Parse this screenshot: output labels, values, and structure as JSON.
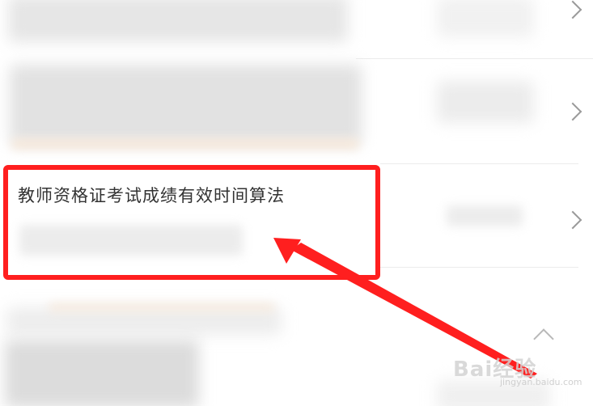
{
  "list": {
    "highlighted_item": {
      "title": "教师资格证考试成绩有效时间算法"
    }
  },
  "watermark": {
    "text": "Bai经验",
    "url": "jingyan.baidu.com"
  },
  "icons": {
    "row_chevron": "chevron-right-icon",
    "scroll_top": "chevron-up-icon"
  },
  "colors": {
    "highlight": "#ff1f1f",
    "arrow": "#ff1f1f",
    "title_text": "#333333"
  }
}
